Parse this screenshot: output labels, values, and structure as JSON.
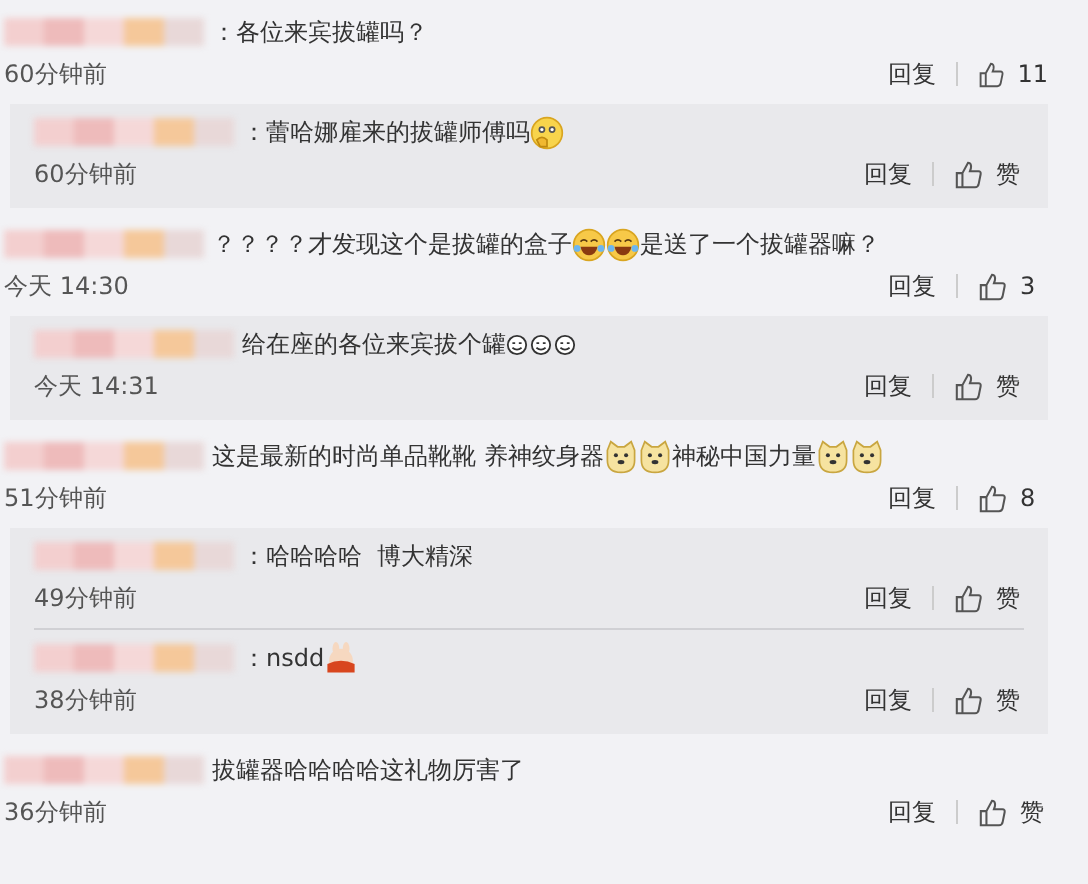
{
  "comments": [
    {
      "segments": [
        {
          "kind": "text",
          "text": "：各位来宾拔罐吗？"
        }
      ],
      "time": "60分钟前",
      "reply": "回复",
      "likes": "11",
      "replies": [
        {
          "segments": [
            {
              "kind": "text",
              "text": "：蕾哈娜雇来的拔罐师傅吗"
            },
            {
              "kind": "think"
            }
          ],
          "time": "60分钟前",
          "reply": "回复",
          "likes": "赞"
        }
      ]
    },
    {
      "segments": [
        {
          "kind": "text",
          "text": "？？？？才发现这个是拔罐的盒子"
        },
        {
          "kind": "laugh"
        },
        {
          "kind": "laugh"
        },
        {
          "kind": "text",
          "text": "是送了一个拔罐器嘛？"
        }
      ],
      "time": "今天 14:30",
      "reply": "回复",
      "likes": "3",
      "replies": [
        {
          "segments": [
            {
              "kind": "text",
              "text": "给在座的各位来宾拔个罐"
            },
            {
              "kind": "small"
            },
            {
              "kind": "small"
            },
            {
              "kind": "small"
            }
          ],
          "time": "今天 14:31",
          "reply": "回复",
          "likes": "赞"
        }
      ]
    },
    {
      "segments": [
        {
          "kind": "text",
          "text": "这是最新的时尚单品靴靴 养神纹身器"
        },
        {
          "kind": "doge"
        },
        {
          "kind": "doge"
        },
        {
          "kind": "text",
          "text": "神秘中国力量"
        },
        {
          "kind": "doge"
        },
        {
          "kind": "doge"
        }
      ],
      "time": "51分钟前",
      "reply": "回复",
      "likes": "8",
      "replies": [
        {
          "segments": [
            {
              "kind": "text",
              "text": "：哈哈哈哈  博大精深"
            }
          ],
          "time": "49分钟前",
          "reply": "回复",
          "likes": "赞"
        },
        {
          "segments": [
            {
              "kind": "text",
              "text": "：nsdd"
            },
            {
              "kind": "hug"
            }
          ],
          "time": "38分钟前",
          "reply": "回复",
          "likes": "赞"
        }
      ]
    },
    {
      "segments": [
        {
          "kind": "text",
          "text": "拔罐器哈哈哈哈这礼物厉害了"
        }
      ],
      "time": "36分钟前",
      "reply": "回复",
      "likes": "赞"
    }
  ]
}
